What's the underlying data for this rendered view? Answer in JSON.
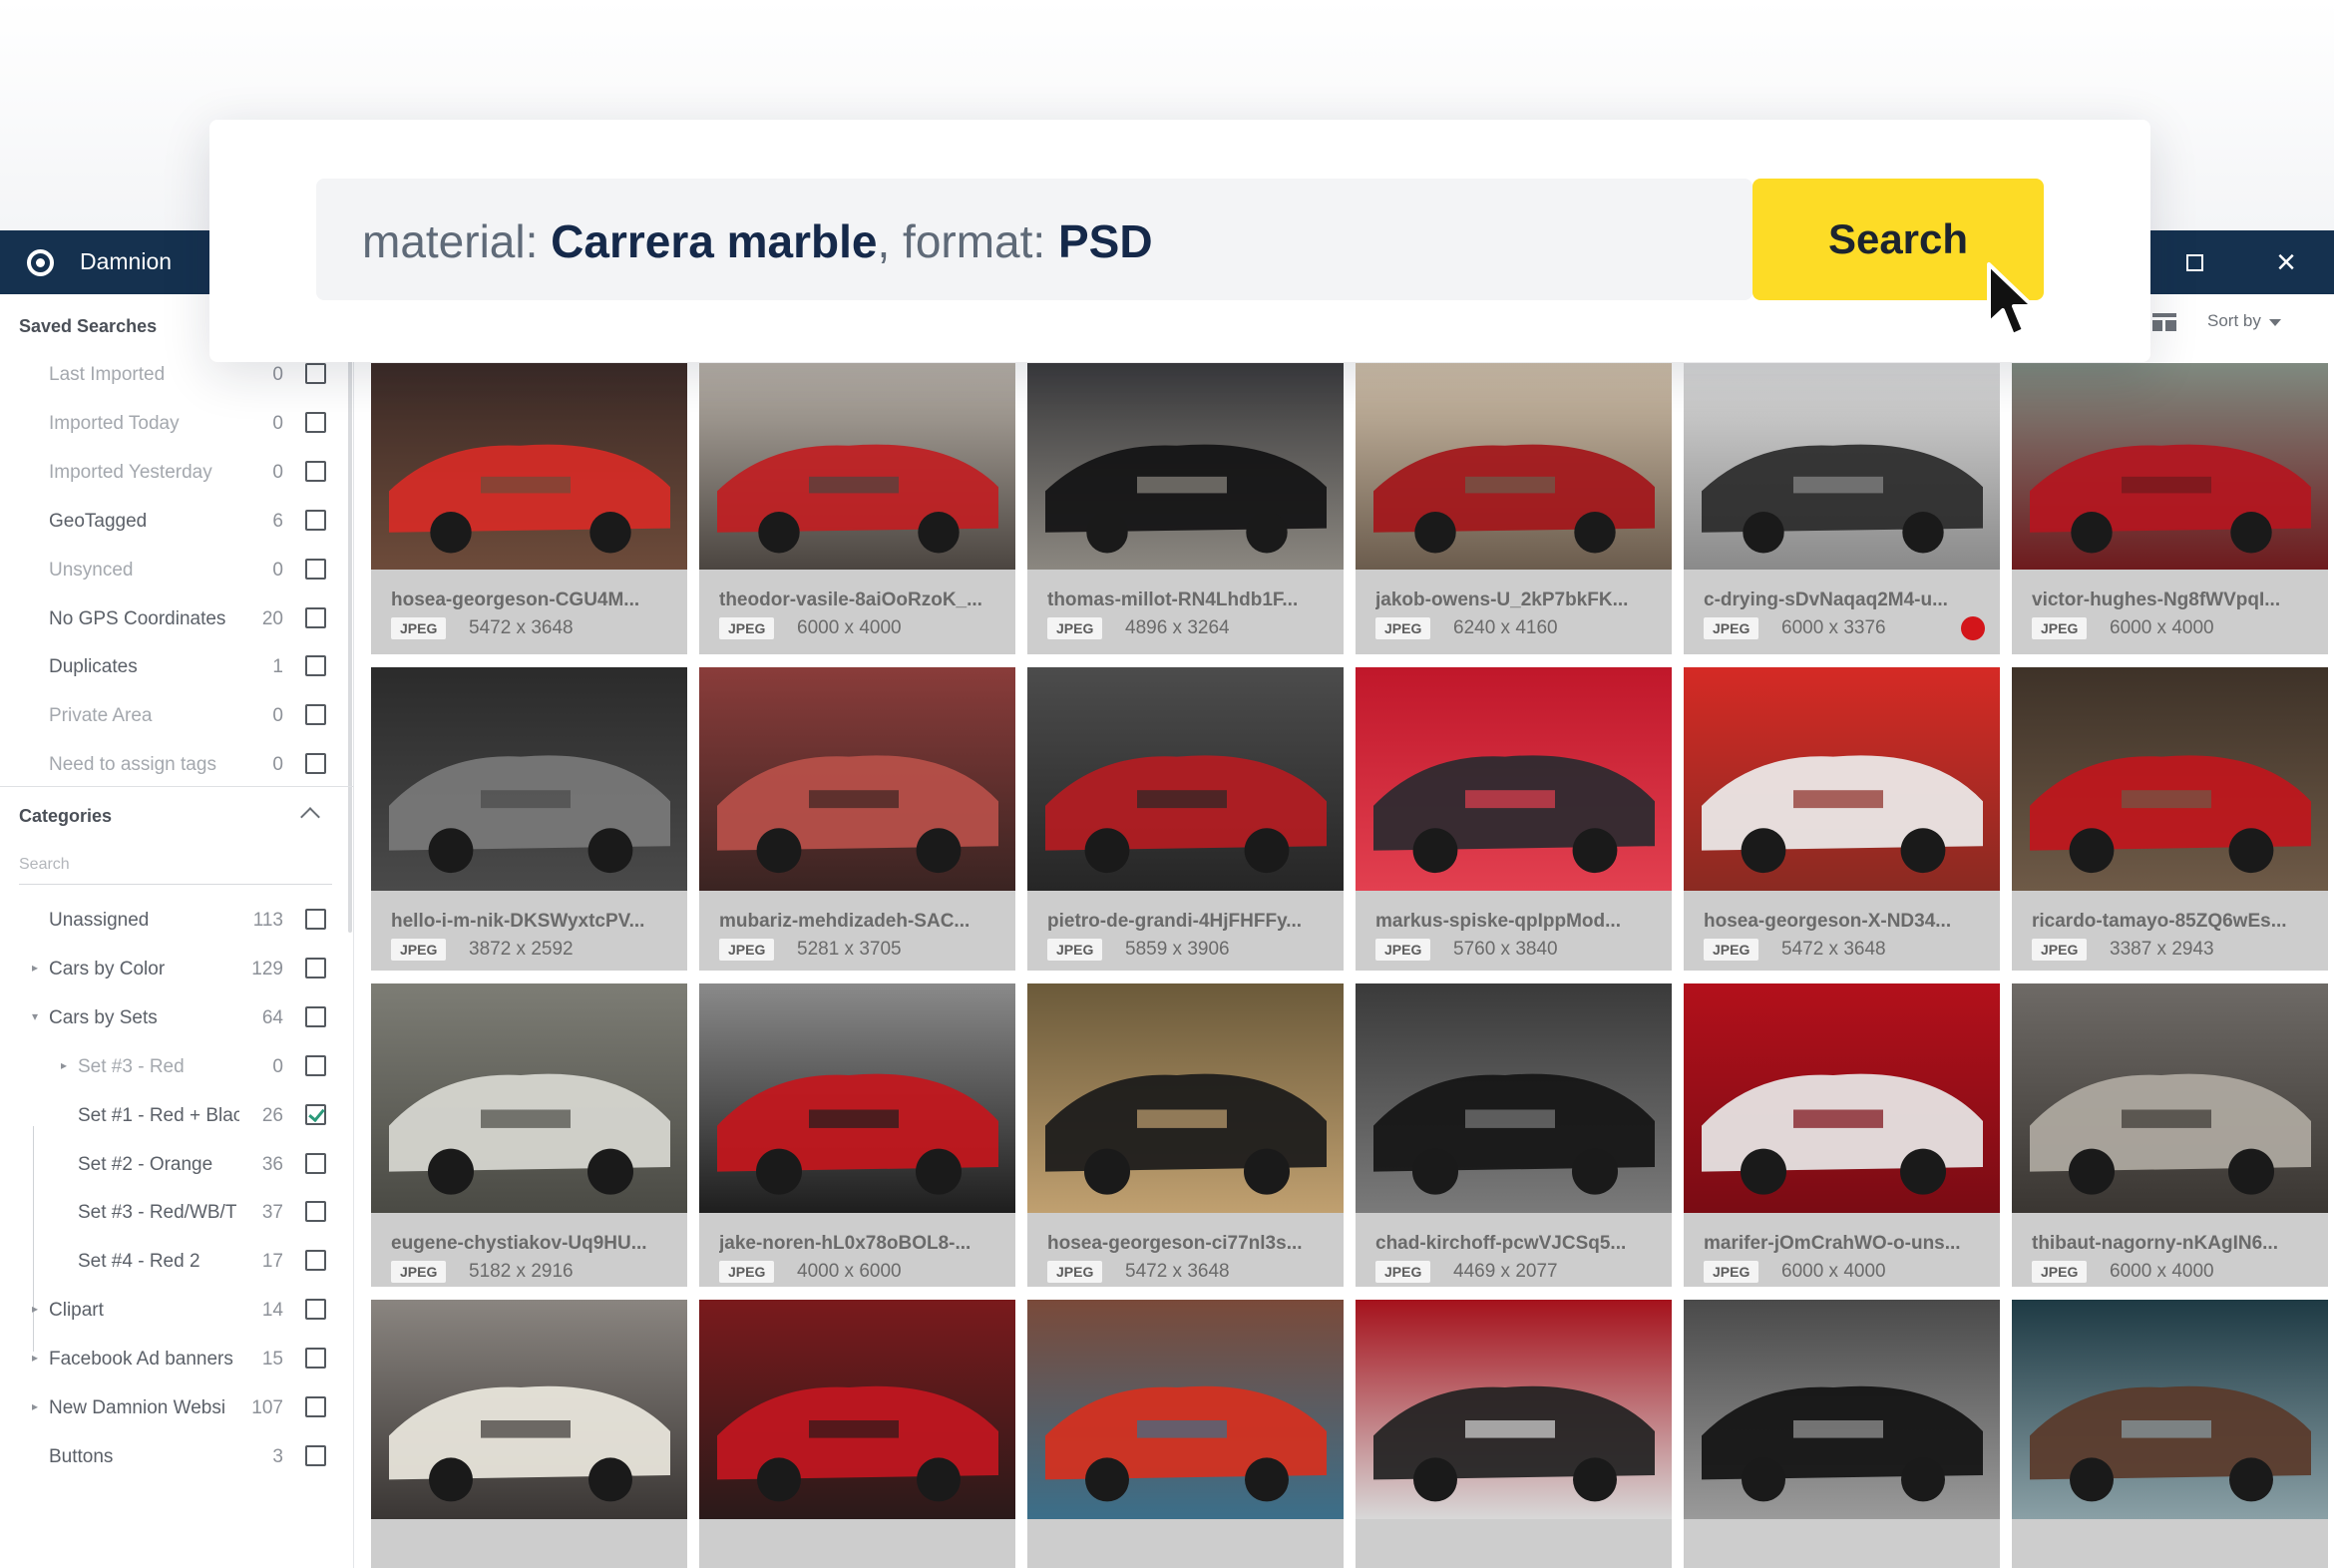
{
  "app": {
    "name": "Damnion",
    "window_controls": [
      "maximize-icon",
      "close-icon"
    ]
  },
  "search": {
    "query_parts": [
      {
        "text": "material: ",
        "bold": false
      },
      {
        "text": "Carrera marble",
        "bold": true
      },
      {
        "text": ", format: ",
        "bold": false
      },
      {
        "text": "PSD",
        "bold": true
      }
    ],
    "button_label": "Search"
  },
  "toolbar": {
    "sort_label": "Sort by"
  },
  "sidebar": {
    "saved_title": "Saved Searches",
    "saved": [
      {
        "label": "Last Imported",
        "count": "0",
        "dim": true
      },
      {
        "label": "Imported Today",
        "count": "0",
        "dim": true
      },
      {
        "label": "Imported Yesterday",
        "count": "0",
        "dim": true
      },
      {
        "label": "GeoTagged",
        "count": "6",
        "dim": false
      },
      {
        "label": "Unsynced",
        "count": "0",
        "dim": true
      },
      {
        "label": "No GPS Coordinates",
        "count": "20",
        "dim": false
      },
      {
        "label": "Duplicates",
        "count": "1",
        "dim": false
      },
      {
        "label": "Private Area",
        "count": "0",
        "dim": true
      },
      {
        "label": "Need to assign tags",
        "count": "0",
        "dim": true
      }
    ],
    "categories_title": "Categories",
    "categories_search_placeholder": "Search",
    "categories": [
      {
        "label": "Unassigned",
        "count": "113",
        "arrow": "",
        "indent": 0,
        "checked": false
      },
      {
        "label": "Cars by Color",
        "count": "129",
        "arrow": "▸",
        "indent": 0,
        "checked": false
      },
      {
        "label": "Cars by Sets",
        "count": "64",
        "arrow": "▾",
        "indent": 0,
        "checked": false
      },
      {
        "label": "Set #3 - Red",
        "count": "0",
        "arrow": "▸",
        "indent": 1,
        "checked": false,
        "dim": true
      },
      {
        "label": "Set #1 - Red + Blac",
        "count": "26",
        "arrow": "",
        "indent": 1,
        "checked": true
      },
      {
        "label": "Set #2 - Orange",
        "count": "36",
        "arrow": "",
        "indent": 1,
        "checked": false
      },
      {
        "label": "Set #3 - Red/WB/T",
        "count": "37",
        "arrow": "",
        "indent": 1,
        "checked": false
      },
      {
        "label": "Set #4 - Red 2",
        "count": "17",
        "arrow": "",
        "indent": 1,
        "checked": false
      },
      {
        "label": "Clipart",
        "count": "14",
        "arrow": "▸",
        "indent": 0,
        "checked": false
      },
      {
        "label": "Facebook Ad banners",
        "count": "15",
        "arrow": "▸",
        "indent": 0,
        "checked": false
      },
      {
        "label": "New Damnion Websi",
        "count": "107",
        "arrow": "▸",
        "indent": 0,
        "checked": false
      },
      {
        "label": "Buttons",
        "count": "3",
        "arrow": "",
        "indent": 0,
        "checked": false
      }
    ]
  },
  "grid": {
    "rows": [
      [
        {
          "name": "hosea-georgeson-CGU4M...",
          "format": "JPEG",
          "dims": "5472 x 3648",
          "palette": [
            "#3b2a26",
            "#d62b26",
            "#6d4b3a"
          ],
          "red_dot": false
        },
        {
          "name": "theodor-vasile-8aiOoRzoK_...",
          "format": "JPEG",
          "dims": "6000 x 4000",
          "palette": [
            "#b8b1a8",
            "#c01e22",
            "#4b4540"
          ],
          "red_dot": false
        },
        {
          "name": "thomas-millot-RN4Lhdb1F...",
          "format": "JPEG",
          "dims": "4896 x 3264",
          "palette": [
            "#3a3a3c",
            "#121214",
            "#8b8780"
          ],
          "red_dot": false
        },
        {
          "name": "jakob-owens-U_2kP7bkFK...",
          "format": "JPEG",
          "dims": "6240 x 4160",
          "palette": [
            "#cfbfa9",
            "#a3161a",
            "#6b5c4d"
          ],
          "red_dot": false
        },
        {
          "name": "c-drying-sDvNaqaq2M4-u...",
          "format": "JPEG",
          "dims": "6000 x 3376",
          "palette": [
            "#d9d9d9",
            "#2a2a2a",
            "#8a8a8a"
          ],
          "red_dot": true
        },
        {
          "name": "victor-hughes-Ng8fWVpqI...",
          "format": "JPEG",
          "dims": "6000 x 4000",
          "palette": [
            "#7f8a80",
            "#b4161f",
            "#6e1a1d"
          ],
          "red_dot": false
        }
      ],
      [
        {
          "name": "hello-i-m-nik-DKSWyxtcPV...",
          "format": "JPEG",
          "dims": "3872 x 2592",
          "palette": [
            "#2b2b2b",
            "#7a7a7a",
            "#4a4a4a"
          ],
          "red_dot": false
        },
        {
          "name": "mubariz-mehdizadeh-SAC...",
          "format": "JPEG",
          "dims": "5281 x 3705",
          "palette": [
            "#8a3c3a",
            "#b8504a",
            "#3a2422"
          ],
          "red_dot": false
        },
        {
          "name": "pietro-de-grandi-4HjFHFFy...",
          "format": "JPEG",
          "dims": "5859 x 3906",
          "palette": [
            "#4c4c4c",
            "#b51c22",
            "#262626"
          ],
          "red_dot": false
        },
        {
          "name": "markus-spiske-qpIppMod...",
          "format": "JPEG",
          "dims": "5760 x 3840",
          "palette": [
            "#c0172a",
            "#2a2a30",
            "#e24050"
          ],
          "red_dot": false
        },
        {
          "name": "hosea-georgeson-X-ND34...",
          "format": "JPEG",
          "dims": "5472 x 3648",
          "palette": [
            "#d52a25",
            "#ededed",
            "#8a2a22"
          ],
          "red_dot": false
        },
        {
          "name": "ricardo-tamayo-85ZQ6wEs...",
          "format": "JPEG",
          "dims": "3387 x 2943",
          "palette": [
            "#3e3228",
            "#c0161c",
            "#6e5a47"
          ],
          "red_dot": false
        }
      ],
      [
        {
          "name": "eugene-chystiakov-Uq9HU...",
          "format": "JPEG",
          "dims": "5182 x 2916",
          "palette": [
            "#7d7d75",
            "#d9d9d2",
            "#4a4a44"
          ],
          "red_dot": false
        },
        {
          "name": "jake-noren-hL0x78oBOL8-...",
          "format": "JPEG",
          "dims": "4000 x 6000",
          "palette": [
            "#8a8a8a",
            "#c4161c",
            "#1e1e1e"
          ],
          "red_dot": false
        },
        {
          "name": "hosea-georgeson-ci77nl3s...",
          "format": "JPEG",
          "dims": "5472 x 3648",
          "palette": [
            "#6b5a3a",
            "#1a1a1a",
            "#c0a070"
          ],
          "red_dot": false
        },
        {
          "name": "chad-kirchoff-pcwVJCSq5...",
          "format": "JPEG",
          "dims": "4469 x 2077",
          "palette": [
            "#3a3a3a",
            "#151515",
            "#7a7a7a"
          ],
          "red_dot": false
        },
        {
          "name": "marifer-jOmCrahWO-o-uns...",
          "format": "JPEG",
          "dims": "6000 x 4000",
          "palette": [
            "#b3101b",
            "#e8e8e8",
            "#7a0c14"
          ],
          "red_dot": false
        },
        {
          "name": "thibaut-nagorny-nKAgIN6...",
          "format": "JPEG",
          "dims": "6000 x 4000",
          "palette": [
            "#6e6a66",
            "#b0aaa2",
            "#3a3632"
          ],
          "red_dot": false
        }
      ],
      [
        {
          "name": "",
          "format": "",
          "dims": "",
          "palette": [
            "#8a8580",
            "#ece8de",
            "#3a3634"
          ],
          "red_dot": false
        },
        {
          "name": "",
          "format": "",
          "dims": "",
          "palette": [
            "#7a1a1c",
            "#c2161f",
            "#2a1a1a"
          ],
          "red_dot": false
        },
        {
          "name": "",
          "format": "",
          "dims": "",
          "palette": [
            "#7a4a3a",
            "#d6301e",
            "#3b6f8a"
          ],
          "red_dot": false
        },
        {
          "name": "",
          "format": "",
          "dims": "",
          "palette": [
            "#a5121c",
            "#222222",
            "#d8d8d8"
          ],
          "red_dot": false
        },
        {
          "name": "",
          "format": "",
          "dims": "",
          "palette": [
            "#4a4a4a",
            "#121212",
            "#9a9a9a"
          ],
          "red_dot": false
        },
        {
          "name": "",
          "format": "",
          "dims": "",
          "palette": [
            "#1e3a44",
            "#5a3a2a",
            "#8aa0a6"
          ],
          "red_dot": false
        }
      ]
    ]
  }
}
